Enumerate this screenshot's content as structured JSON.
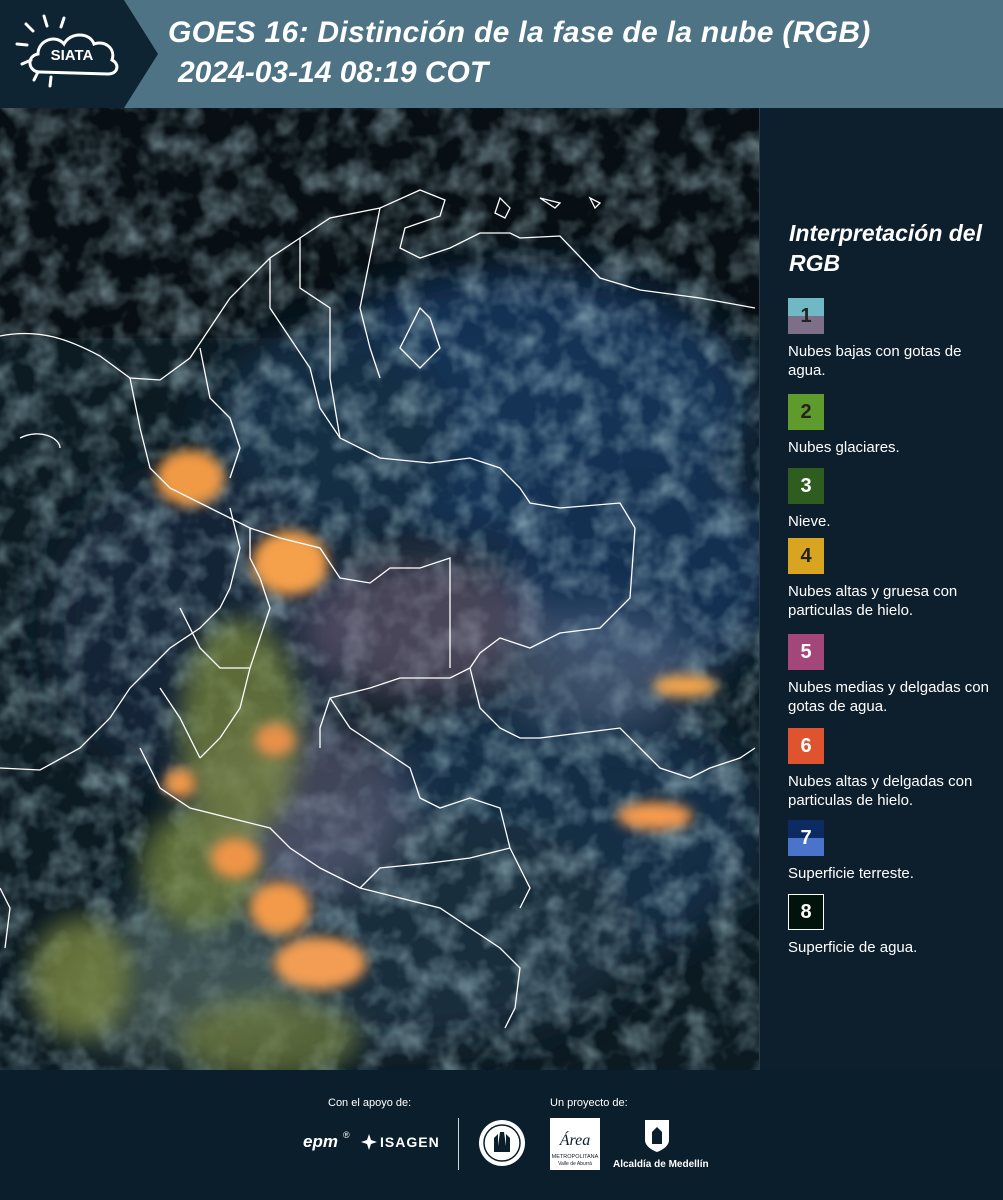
{
  "header": {
    "logo_text": "SIATA",
    "title": "GOES 16: Distinción de la fase de la nube (RGB)",
    "timestamp": "2024-03-14 08:19 COT",
    "color": "#4d7384"
  },
  "legend": {
    "title": "Interpretación del RGB",
    "items": [
      {
        "number": "1",
        "label": "Nubes bajas con gotas de agua.",
        "colors": [
          "#6fb8c4",
          "#7e6f88"
        ]
      },
      {
        "number": "2",
        "label": "Nubes glaciares.",
        "colors": [
          "#5f9a2c"
        ]
      },
      {
        "number": "3",
        "label": "Nieve.",
        "colors": [
          "#2f5c1f"
        ]
      },
      {
        "number": "4",
        "label": "Nubes altas y gruesa con particulas de hielo.",
        "colors": [
          "#d9a41f"
        ]
      },
      {
        "number": "5",
        "label": "Nubes medias y delgadas con gotas de agua.",
        "colors": [
          "#a3477a"
        ]
      },
      {
        "number": "6",
        "label": "Nubes altas y delgadas con particulas de hielo.",
        "colors": [
          "#e0532f"
        ]
      },
      {
        "number": "7",
        "label": "Superficie terreste.",
        "colors": [
          "#0c2b63",
          "#4a74c9"
        ]
      },
      {
        "number": "8",
        "label": "Superficie de agua.",
        "colors": [
          "#02130c"
        ]
      }
    ]
  },
  "footer": {
    "support_label": "Con el apoyo de:",
    "project_label": "Un proyecto de:",
    "sponsors": [
      "epm",
      "ISAGEN"
    ],
    "area_logo_text": "Área",
    "area_caption_1": "METROPOLITANA",
    "area_caption_2": "Valle de Aburrá",
    "medellin_caption": "Alcaldía de Medellín"
  }
}
